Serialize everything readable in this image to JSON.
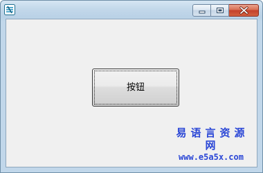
{
  "window": {
    "icon": "app-logo-icon",
    "caption_buttons": [
      {
        "name": "minimize-button",
        "icon": "minimize-icon"
      },
      {
        "name": "maximize-button",
        "icon": "maximize-icon"
      },
      {
        "name": "close-button",
        "icon": "close-icon"
      }
    ]
  },
  "main": {
    "button_label": "按钮"
  },
  "watermark": {
    "title": "易语言资源网",
    "url": "www.e5a5x.com"
  },
  "colors": {
    "titlebar": "#c3d8ea",
    "client_background": "#f0f0f0",
    "close_button": "#c4402a",
    "watermark_text": "#2a46d6"
  }
}
